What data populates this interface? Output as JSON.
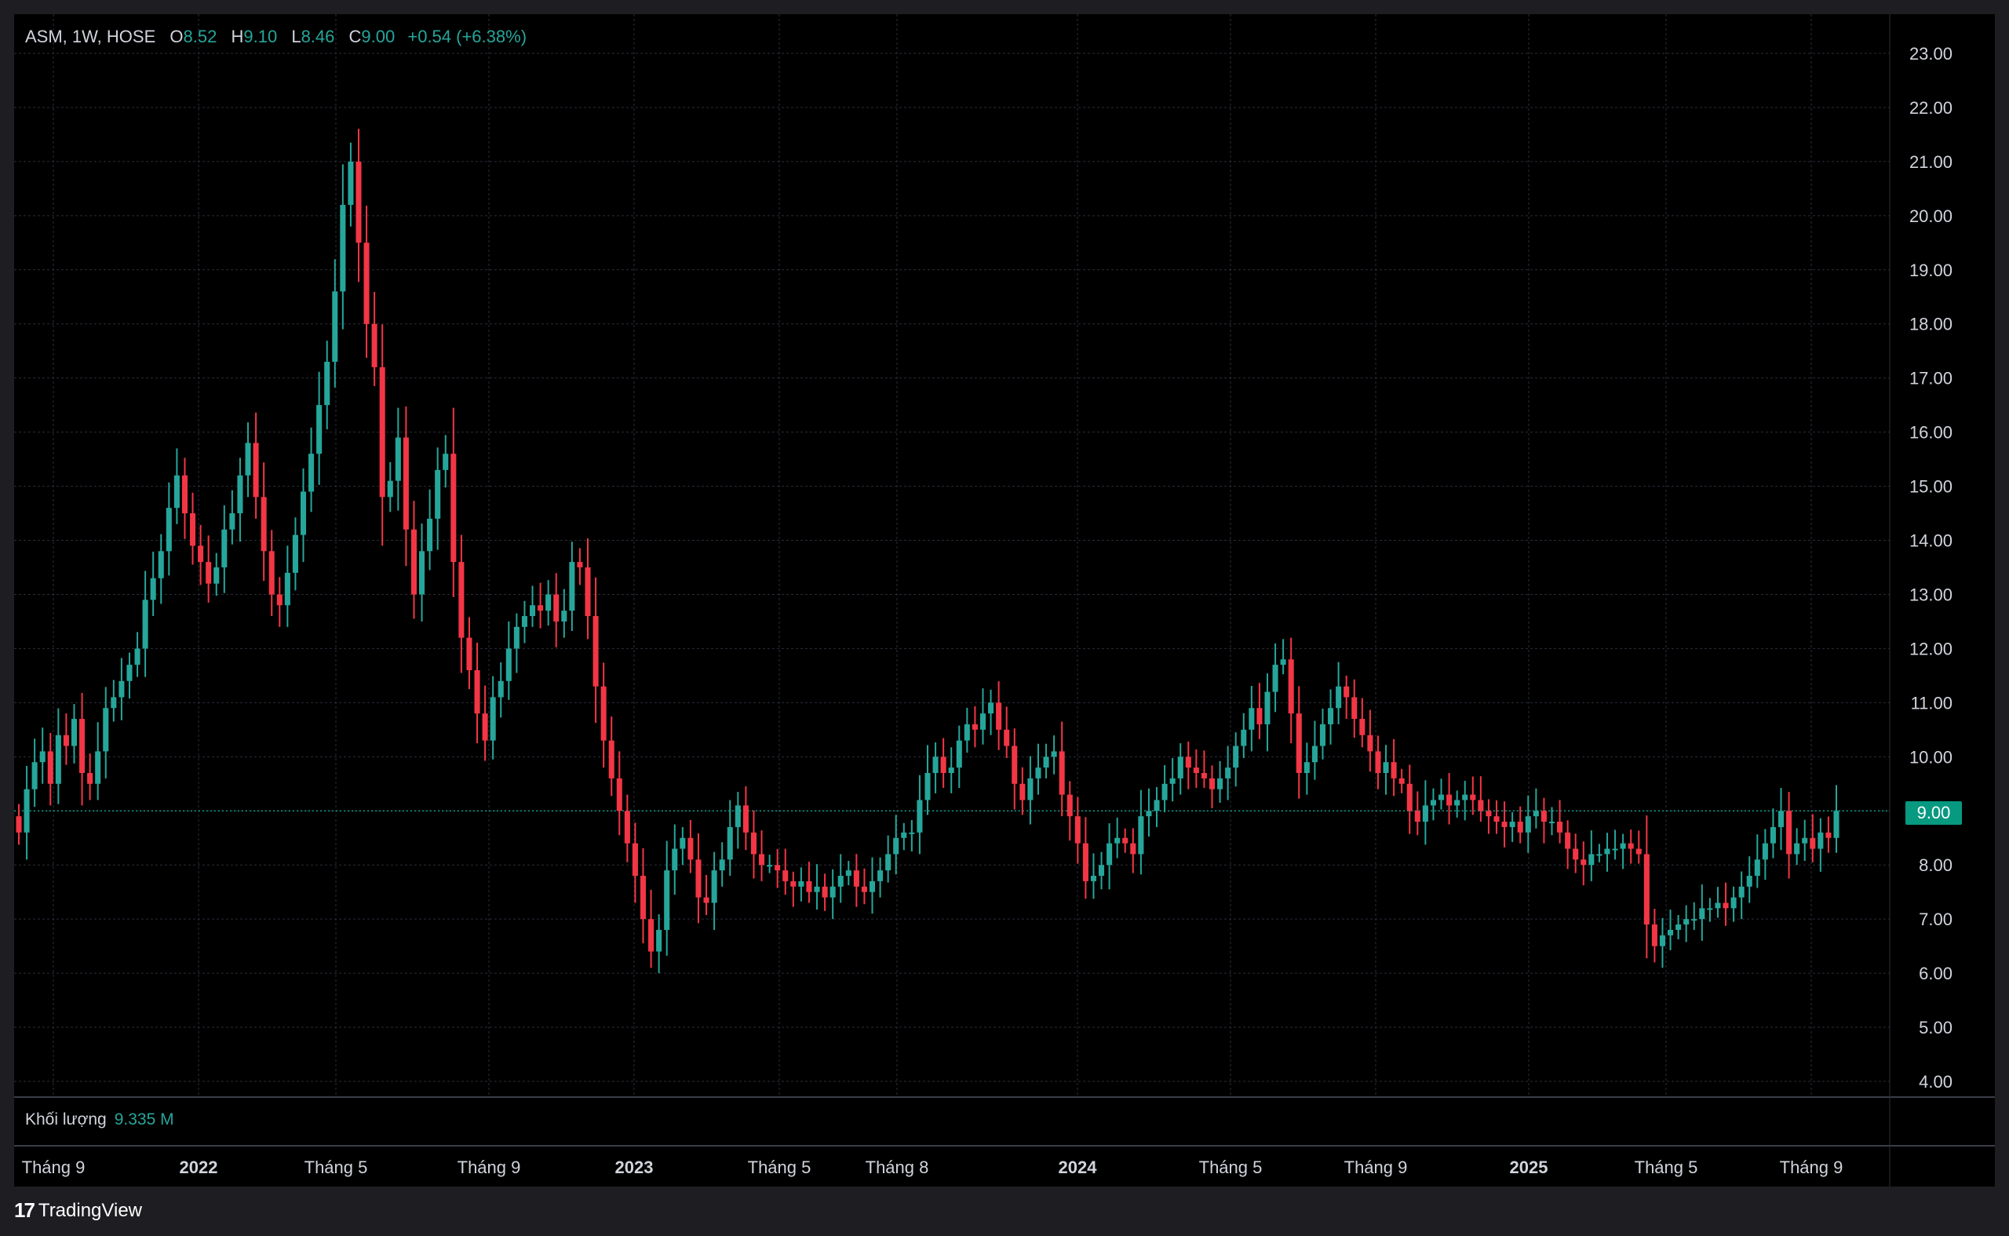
{
  "legend": {
    "symbol": "ASM, 1W, HOSE",
    "o_label": "O",
    "o_value": "8.52",
    "h_label": "H",
    "h_value": "9.10",
    "l_label": "L",
    "l_value": "8.46",
    "c_label": "C",
    "c_value": "9.00",
    "change": "+0.54 (+6.38%)"
  },
  "volume": {
    "label": "Khối lượng",
    "value": "9.335 M"
  },
  "last_price": "9.00",
  "brand": {
    "logo_text": "17",
    "name": "TradingView"
  },
  "colors": {
    "up": "#26a69a",
    "down": "#f23645",
    "background": "#000000",
    "grid": "#2a2e39",
    "price_line": "#089981"
  },
  "chart_data": {
    "type": "candlestick",
    "interval": "1W",
    "ylim": [
      4,
      23
    ],
    "y_ticks": [
      "23.00",
      "22.00",
      "21.00",
      "20.00",
      "19.00",
      "18.00",
      "17.00",
      "16.00",
      "15.00",
      "14.00",
      "13.00",
      "12.00",
      "11.00",
      "10.00",
      "9.00",
      "8.00",
      "7.00",
      "6.00",
      "5.00",
      "4.00"
    ],
    "x_ticks": [
      {
        "label": "Tháng 9",
        "bold": false
      },
      {
        "label": "2022",
        "bold": true
      },
      {
        "label": "Tháng 5",
        "bold": false
      },
      {
        "label": "Tháng 9",
        "bold": false
      },
      {
        "label": "2023",
        "bold": true
      },
      {
        "label": "Tháng 5",
        "bold": false
      },
      {
        "label": "Tháng 8",
        "bold": false
      },
      {
        "label": "2024",
        "bold": true
      },
      {
        "label": "Tháng 5",
        "bold": false
      },
      {
        "label": "Tháng 9",
        "bold": false
      },
      {
        "label": "2025",
        "bold": true
      },
      {
        "label": "Tháng 5",
        "bold": false
      },
      {
        "label": "Tháng 9",
        "bold": false
      }
    ],
    "grid": true,
    "last_close": 9.0,
    "closes": [
      8.6,
      9.4,
      9.9,
      10.1,
      9.5,
      10.4,
      10.2,
      10.7,
      9.7,
      9.5,
      10.1,
      10.9,
      11.1,
      11.4,
      11.7,
      12.0,
      12.9,
      13.3,
      13.8,
      14.6,
      15.2,
      14.5,
      13.9,
      13.6,
      13.2,
      13.5,
      14.2,
      14.5,
      15.2,
      15.8,
      14.8,
      13.8,
      13.0,
      12.8,
      13.4,
      14.1,
      14.9,
      15.6,
      16.5,
      17.3,
      18.6,
      20.2,
      21.0,
      19.5,
      18.0,
      17.2,
      14.8,
      15.1,
      15.9,
      14.2,
      13.0,
      13.8,
      14.4,
      15.3,
      15.6,
      13.6,
      12.2,
      11.6,
      10.8,
      10.3,
      11.1,
      11.4,
      12.0,
      12.4,
      12.6,
      12.8,
      12.7,
      13.0,
      12.5,
      12.7,
      13.6,
      13.5,
      12.6,
      11.3,
      10.3,
      9.6,
      9.0,
      8.4,
      7.8,
      7.0,
      6.4,
      6.8,
      7.9,
      8.3,
      8.5,
      8.1,
      7.4,
      7.3,
      7.9,
      8.1,
      8.7,
      9.1,
      8.6,
      8.2,
      8.0,
      8.0,
      7.9,
      7.7,
      7.6,
      7.7,
      7.5,
      7.6,
      7.4,
      7.6,
      7.8,
      7.9,
      7.6,
      7.5,
      7.7,
      7.9,
      8.2,
      8.5,
      8.6,
      8.6,
      9.2,
      9.7,
      10.0,
      9.7,
      9.8,
      10.3,
      10.6,
      10.5,
      10.8,
      11.0,
      10.5,
      10.2,
      9.5,
      9.2,
      9.6,
      9.8,
      10.0,
      10.1,
      9.3,
      8.9,
      8.4,
      7.7,
      7.8,
      8.0,
      8.4,
      8.5,
      8.4,
      8.2,
      8.9,
      9.0,
      9.2,
      9.5,
      9.6,
      10.0,
      9.8,
      9.7,
      9.6,
      9.4,
      9.6,
      9.8,
      10.2,
      10.5,
      10.9,
      10.6,
      11.2,
      11.7,
      11.8,
      10.8,
      9.7,
      9.9,
      10.2,
      10.6,
      10.9,
      11.3,
      11.1,
      10.7,
      10.4,
      10.1,
      9.7,
      9.9,
      9.6,
      9.5,
      9.0,
      8.8,
      9.1,
      9.2,
      9.3,
      9.1,
      9.2,
      9.3,
      9.2,
      9.0,
      8.9,
      8.8,
      8.7,
      8.8,
      8.6,
      8.9,
      9.0,
      8.8,
      8.8,
      8.6,
      8.3,
      8.1,
      8.0,
      8.2,
      8.2,
      8.3,
      8.3,
      8.4,
      8.3,
      8.2,
      6.9,
      6.5,
      6.7,
      6.8,
      6.9,
      7.0,
      7.0,
      7.2,
      7.2,
      7.3,
      7.2,
      7.4,
      7.6,
      7.8,
      8.1,
      8.4,
      8.7,
      9.0,
      8.2,
      8.4,
      8.5,
      8.3,
      8.6,
      8.5,
      9.0
    ]
  }
}
